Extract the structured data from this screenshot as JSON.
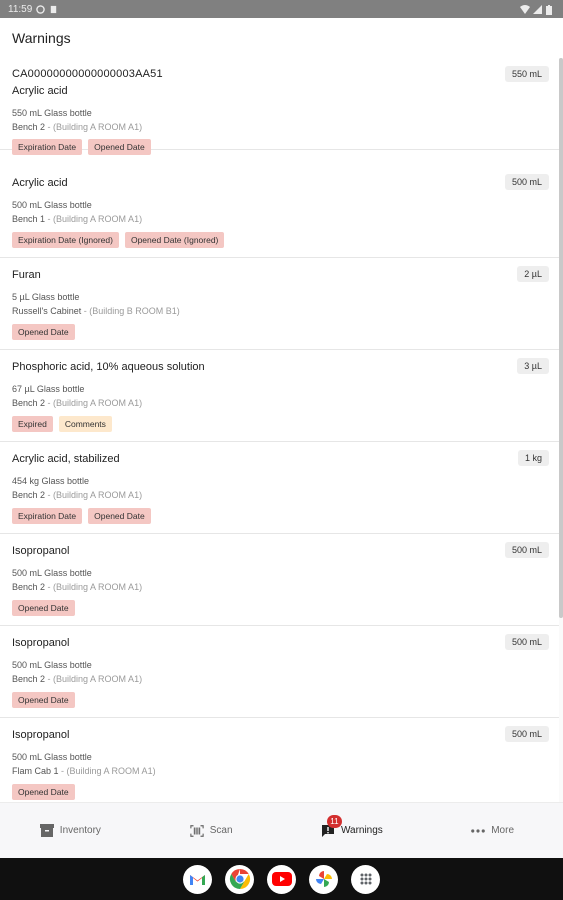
{
  "status_bar": {
    "time": "11:59"
  },
  "header": {
    "title": "Warnings"
  },
  "items": [
    {
      "id": "CA00000000000000003AA51",
      "name": "Acrylic acid",
      "quantity": "550 mL",
      "description": "550 mL Glass bottle",
      "location": "Bench 2",
      "building": " - (Building A ROOM A1)",
      "tags": [
        {
          "label": "Expiration Date",
          "color": "red"
        },
        {
          "label": "Opened Date",
          "color": "red"
        }
      ]
    },
    {
      "id": "",
      "name": "Acrylic acid",
      "quantity": "500 mL",
      "description": "500 mL Glass bottle",
      "location": "Bench 1",
      "building": " - (Building A ROOM A1)",
      "tags": [
        {
          "label": "Expiration Date (Ignored)",
          "color": "red"
        },
        {
          "label": "Opened Date (Ignored)",
          "color": "red"
        }
      ]
    },
    {
      "id": "",
      "name": "Furan",
      "quantity": "2 µL",
      "description": "5 µL Glass bottle",
      "location": "Russell's Cabinet",
      "building": " - (Building B ROOM B1)",
      "tags": [
        {
          "label": "Opened Date",
          "color": "red"
        }
      ]
    },
    {
      "id": "",
      "name": "Phosphoric acid, 10% aqueous solution",
      "quantity": "3 µL",
      "description": "67 µL Glass bottle",
      "location": "Bench 2",
      "building": " - (Building A ROOM A1)",
      "tags": [
        {
          "label": "Expired",
          "color": "red"
        },
        {
          "label": "Comments",
          "color": "amber"
        }
      ]
    },
    {
      "id": "",
      "name": "Acrylic acid, stabilized",
      "quantity": "1 kg",
      "description": "454 kg Glass bottle",
      "location": "Bench 2",
      "building": " - (Building A ROOM A1)",
      "tags": [
        {
          "label": "Expiration Date",
          "color": "red"
        },
        {
          "label": "Opened Date",
          "color": "red"
        }
      ]
    },
    {
      "id": "",
      "name": "Isopropanol",
      "quantity": "500 mL",
      "description": "500 mL Glass bottle",
      "location": "Bench 2",
      "building": " - (Building A ROOM A1)",
      "tags": [
        {
          "label": "Opened Date",
          "color": "red"
        }
      ]
    },
    {
      "id": "",
      "name": "Isopropanol",
      "quantity": "500 mL",
      "description": "500 mL Glass bottle",
      "location": "Bench 2",
      "building": " - (Building A ROOM A1)",
      "tags": [
        {
          "label": "Opened Date",
          "color": "red"
        }
      ]
    },
    {
      "id": "",
      "name": "Isopropanol",
      "quantity": "500 mL",
      "description": "500 mL Glass bottle",
      "location": "Flam Cab 1",
      "building": " - (Building A ROOM A1)",
      "tags": [
        {
          "label": "Opened Date",
          "color": "red"
        }
      ]
    }
  ],
  "bottom_nav": [
    {
      "label": "Inventory",
      "icon": "archive-icon",
      "active": false
    },
    {
      "label": "Scan",
      "icon": "barcode-scan-icon",
      "active": false
    },
    {
      "label": "Warnings",
      "icon": "warning-icon",
      "active": true,
      "badge": "11"
    },
    {
      "label": "More",
      "icon": "more-dots-icon",
      "active": false
    }
  ],
  "dock": [
    "gmail-icon",
    "chrome-icon",
    "youtube-icon",
    "photos-icon",
    "app-drawer-icon"
  ],
  "colors": {
    "tag_red": "#f4c7c3",
    "tag_amber": "#fde8cc",
    "badge": "#d32f2f"
  }
}
